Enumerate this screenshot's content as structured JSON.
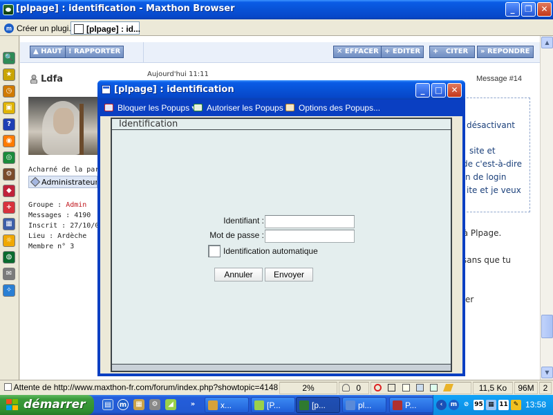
{
  "window": {
    "title": "[plpage] : identification - Maxthon Browser",
    "minimize": "_",
    "maximize": "❐",
    "close": "✕"
  },
  "tabs": [
    {
      "label": "Créer un plugi...",
      "icon": "maxthon-icon"
    },
    {
      "label": "[plpage] : id...",
      "icon": "page-icon"
    }
  ],
  "sidebar": {
    "items": [
      {
        "name": "search-icon",
        "glyph": "🔍",
        "color": "#2e8b57"
      },
      {
        "name": "favorites-icon",
        "glyph": "★",
        "color": "#c9a400"
      },
      {
        "name": "history-icon",
        "glyph": "◷",
        "color": "#d07a00"
      },
      {
        "name": "groups-icon",
        "glyph": "▣",
        "color": "#e0b400"
      },
      {
        "name": "help-icon",
        "glyph": "?",
        "color": "#1f3fb4"
      },
      {
        "name": "rss-icon",
        "glyph": "◉",
        "color": "#ff7b00"
      },
      {
        "name": "web-icon",
        "glyph": "◎",
        "color": "#1b8b3b"
      },
      {
        "name": "plugin-icon",
        "glyph": "⚙",
        "color": "#7a4b2a"
      },
      {
        "name": "collector-icon",
        "glyph": "◆",
        "color": "#c0223a"
      },
      {
        "name": "add-icon",
        "glyph": "+",
        "color": "#d8323c"
      },
      {
        "name": "calendar-icon",
        "glyph": "▦",
        "color": "#3d5fa8"
      },
      {
        "name": "weather-icon",
        "glyph": "☼",
        "color": "#f0a800"
      },
      {
        "name": "globe-icon",
        "glyph": "◍",
        "color": "#0a6b2e"
      },
      {
        "name": "mail-icon",
        "glyph": "✉",
        "color": "#7b7b7b"
      },
      {
        "name": "puzzle-icon",
        "glyph": "✧",
        "color": "#2a7fd4"
      }
    ]
  },
  "page": {
    "buttons": {
      "haut": "HAUT",
      "rapporter": "! RAPPORTER",
      "effacer": "EFFACER",
      "editer": "EDITER",
      "citer": "CITER",
      "repondre": "REPONDRE"
    },
    "author": "Ldfa",
    "header_row": "Aujourd'hui 11:11",
    "message_number": "Message #14",
    "user_title": "Acharné de la par",
    "group_badge": "Administrateurs",
    "user_info": [
      {
        "label": "Groupe : ",
        "value": "Admin"
      },
      {
        "label": "Messages : 4190",
        "value": ""
      },
      {
        "label": "Inscrit : 27/10/01",
        "value": ""
      },
      {
        "label": "Lieu : Ardèche",
        "value": ""
      },
      {
        "label": "Membre n° 3",
        "value": ""
      }
    ],
    "post_lines": [
      "désactivant",
      "site et",
      "de c'est-à-dire",
      "n de login",
      "ite et je veux"
    ],
    "post_lines_2": [
      "r à Plpage.",
      "sans que tu",
      "er"
    ]
  },
  "dialog": {
    "title": "[plpage] : identification",
    "popup_bar": {
      "block": "Bloquer les Popups",
      "allow": "Autoriser les Popups",
      "options": "Options des Popups..."
    },
    "header": "Identification",
    "username_label": "Identifiant :",
    "username_value": "",
    "password_label": "Mot de passe :",
    "password_value": "",
    "auto_login_label": "Identification automatique",
    "auto_login_checked": false,
    "cancel": "Annuler",
    "submit": "Envoyer"
  },
  "statusbar": {
    "text": "Attente de http://www.maxthon-fr.com/forum/index.php?showtopic=4148...",
    "progress": "2%",
    "downloads": "0",
    "size": "11,5 Ko",
    "memory": "96M",
    "count": "2"
  },
  "taskbar": {
    "start_label": "démarrer",
    "tasks": [
      {
        "label": "x...",
        "color": "#d6a23a"
      },
      {
        "label": "[P...",
        "color": "#9ad04a"
      },
      {
        "label": "[p...",
        "color": "#2f7a2f"
      },
      {
        "label": "pl...",
        "color": "#5a8ad8"
      },
      {
        "label": "P...",
        "color": "#b03030"
      }
    ],
    "tray_number": "95",
    "tray_date": "11",
    "clock": "13:58"
  }
}
